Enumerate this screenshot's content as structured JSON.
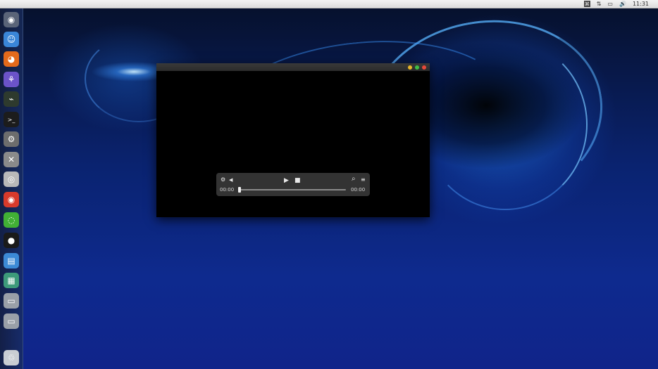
{
  "topbar": {
    "tray": [
      {
        "name": "app-indicator-icon",
        "glyph": "⌘"
      },
      {
        "name": "network-icon",
        "glyph": "⇅"
      },
      {
        "name": "battery-icon",
        "glyph": "▭"
      },
      {
        "name": "volume-icon",
        "glyph": "🔊"
      }
    ],
    "clock": "11:31",
    "apple_glyph": ""
  },
  "dock": {
    "items": [
      {
        "name": "dock-ubuntu-icon",
        "glyph": "◉",
        "bg": "#5a6478"
      },
      {
        "name": "dock-finder-icon",
        "glyph": "☺",
        "bg": "#3a86d8"
      },
      {
        "name": "dock-firefox-icon",
        "glyph": "◕",
        "bg": "#e46a1b"
      },
      {
        "name": "dock-app-store-icon",
        "glyph": "⚘",
        "bg": "#6b53c9"
      },
      {
        "name": "dock-system-monitor-icon",
        "glyph": "⌁",
        "bg": "#2e3a2e"
      },
      {
        "name": "dock-terminal-icon",
        "glyph": ">_",
        "bg": "#1c1c1c"
      },
      {
        "name": "dock-settings-icon",
        "glyph": "⚙",
        "bg": "#6d6d6d"
      },
      {
        "name": "dock-tools-icon",
        "glyph": "✕",
        "bg": "#8a8a8a"
      },
      {
        "name": "dock-dvd-icon",
        "glyph": "◎",
        "bg": "#b9b9b9"
      },
      {
        "name": "dock-browser-icon",
        "glyph": "◉",
        "bg": "#d83a2b"
      },
      {
        "name": "dock-wechat-icon",
        "glyph": "◌",
        "bg": "#41b035"
      },
      {
        "name": "dock-qq-icon",
        "glyph": "●",
        "bg": "#1a1a1a"
      },
      {
        "name": "dock-files-icon",
        "glyph": "▤",
        "bg": "#3c8ad6"
      },
      {
        "name": "dock-archive-icon",
        "glyph": "▦",
        "bg": "#3d9a7a"
      },
      {
        "name": "dock-drive-1-icon",
        "glyph": "▭",
        "bg": "#9aa0a8"
      },
      {
        "name": "dock-drive-2-icon",
        "glyph": "▭",
        "bg": "#9aa0a8"
      },
      {
        "name": "dock-trash-icon",
        "glyph": "♲",
        "bg": "#c9cdd3"
      }
    ]
  },
  "player": {
    "current_time": "00:00",
    "total_time": "00:00",
    "progress": 0,
    "icons": {
      "settings": "⚙",
      "volume": "◀",
      "play": "▶",
      "stop": "■",
      "search": "⌕",
      "playlist": "≡"
    },
    "traffic_lights": {
      "minimize": "#e8b52a",
      "maximize": "#3fbe45",
      "close": "#e8483a"
    }
  }
}
